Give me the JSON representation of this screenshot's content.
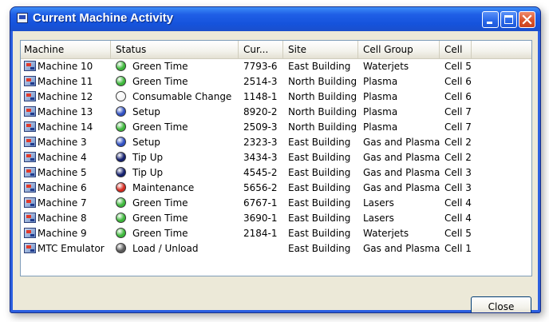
{
  "window": {
    "title": "Current Machine Activity"
  },
  "colors": {
    "green": "#3cb63a",
    "white": "#f4f4f4",
    "blue": "#2f4fc0",
    "navy": "#14206e",
    "red": "#d42a1f",
    "gray": "#5a5a5a"
  },
  "columns": [
    "Machine",
    "Status",
    "Cur...",
    "Site",
    "Cell Group",
    "Cell"
  ],
  "rows": [
    {
      "machine": "Machine 10",
      "status": "Green Time",
      "status_color": "green",
      "cur": "7793-6",
      "site": "East Building",
      "group": "Waterjets",
      "cell": "Cell 5"
    },
    {
      "machine": "Machine 11",
      "status": "Green Time",
      "status_color": "green",
      "cur": "2514-3",
      "site": "North Building",
      "group": "Plasma",
      "cell": "Cell 6"
    },
    {
      "machine": "Machine 12",
      "status": "Consumable Change",
      "status_color": "white",
      "cur": "1148-1",
      "site": "North Building",
      "group": "Plasma",
      "cell": "Cell 6"
    },
    {
      "machine": "Machine 13",
      "status": "Setup",
      "status_color": "blue",
      "cur": "8920-2",
      "site": "North Building",
      "group": "Plasma",
      "cell": "Cell 7"
    },
    {
      "machine": "Machine 14",
      "status": "Green Time",
      "status_color": "green",
      "cur": "2509-3",
      "site": "North Building",
      "group": "Plasma",
      "cell": "Cell 7"
    },
    {
      "machine": "Machine 3",
      "status": "Setup",
      "status_color": "blue",
      "cur": "2323-3",
      "site": "East Building",
      "group": "Gas and Plasma",
      "cell": "Cell 2"
    },
    {
      "machine": "Machine 4",
      "status": "Tip Up",
      "status_color": "navy",
      "cur": "3434-3",
      "site": "East Building",
      "group": "Gas and Plasma",
      "cell": "Cell 2"
    },
    {
      "machine": "Machine 5",
      "status": "Tip Up",
      "status_color": "navy",
      "cur": "4545-2",
      "site": "East Building",
      "group": "Gas and Plasma",
      "cell": "Cell 3"
    },
    {
      "machine": "Machine 6",
      "status": "Maintenance",
      "status_color": "red",
      "cur": "5656-2",
      "site": "East Building",
      "group": "Gas and Plasma",
      "cell": "Cell 3"
    },
    {
      "machine": "Machine 7",
      "status": "Green Time",
      "status_color": "green",
      "cur": "6767-1",
      "site": "East Building",
      "group": "Lasers",
      "cell": "Cell 4"
    },
    {
      "machine": "Machine 8",
      "status": "Green Time",
      "status_color": "green",
      "cur": "3690-1",
      "site": "East Building",
      "group": "Lasers",
      "cell": "Cell 4"
    },
    {
      "machine": "Machine 9",
      "status": "Green Time",
      "status_color": "green",
      "cur": "2184-1",
      "site": "East Building",
      "group": "Waterjets",
      "cell": "Cell 5"
    },
    {
      "machine": "MTC Emulator",
      "status": "Load / Unload",
      "status_color": "gray",
      "cur": "",
      "site": "East Building",
      "group": "Gas and Plasma",
      "cell": "Cell 1"
    }
  ],
  "buttons": {
    "close": "Close"
  }
}
